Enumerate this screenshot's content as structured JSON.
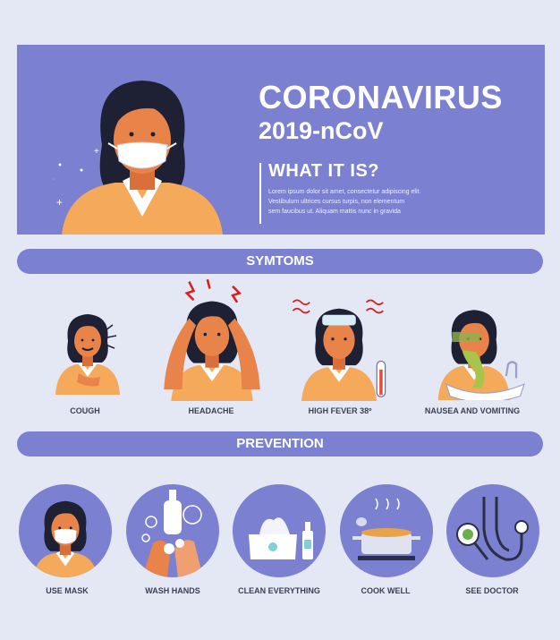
{
  "header": {
    "title_line1": "CORONAVIRUS",
    "title_line2": "2019-nCoV",
    "subtitle": "WHAT IT IS?",
    "body_lines": [
      "Lorem ipsum dolor sit amet, consectetur adipiscing elit.",
      "Vestibulum ultrices cursus turpis, non elementum",
      "sem faucibus ut. Aliquam mattis nunc in gravida"
    ]
  },
  "symptoms": {
    "heading": "SYMTOMS",
    "items": [
      {
        "label": "COUGH",
        "icon": "cough-woman-icon"
      },
      {
        "label": "HEADACHE",
        "icon": "headache-woman-icon"
      },
      {
        "label": "HIGH FEVER 38º",
        "icon": "fever-woman-icon"
      },
      {
        "label": "NAUSEA AND VOMITING",
        "icon": "vomiting-woman-icon"
      }
    ]
  },
  "prevention": {
    "heading": "PREVENTION",
    "items": [
      {
        "label": "USE MASK",
        "icon": "mask-woman-icon"
      },
      {
        "label": "WASH HANDS",
        "icon": "wash-hands-icon"
      },
      {
        "label": "CLEAN EVERYTHING",
        "icon": "tissue-sanitizer-icon"
      },
      {
        "label": "COOK WELL",
        "icon": "cooking-pot-icon"
      },
      {
        "label": "SEE DOCTOR",
        "icon": "stethoscope-icon"
      }
    ]
  },
  "colors": {
    "background": "#e4e8f5",
    "accent": "#7b80d1",
    "skin": "#e8834a",
    "shirt": "#f5a95a",
    "hair": "#1e2133"
  }
}
